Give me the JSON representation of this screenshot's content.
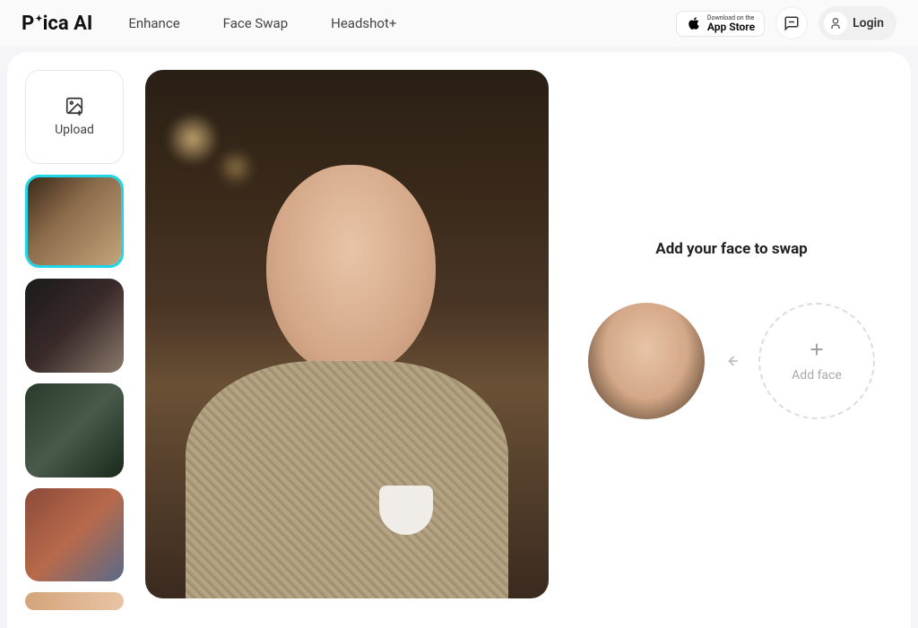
{
  "header": {
    "logo": "Pica AI",
    "nav": {
      "enhance": "Enhance",
      "faceswap": "Face Swap",
      "headshot": "Headshot+"
    },
    "appstore": {
      "small": "Download on the",
      "big": "App Store"
    },
    "login": "Login"
  },
  "sidebar": {
    "upload": "Upload"
  },
  "panel": {
    "title": "Add your face to swap",
    "addface": "Add face"
  }
}
